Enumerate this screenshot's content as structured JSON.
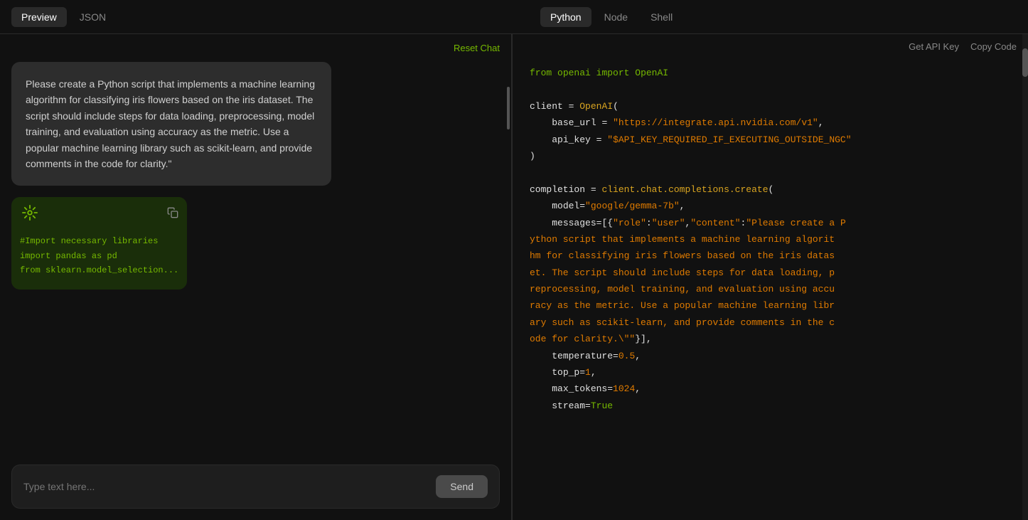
{
  "topbar": {
    "left_tabs": [
      {
        "id": "preview",
        "label": "Preview",
        "active": true
      },
      {
        "id": "json",
        "label": "JSON",
        "active": false
      }
    ],
    "right_tabs": [
      {
        "id": "python",
        "label": "Python",
        "active": true
      },
      {
        "id": "node",
        "label": "Node",
        "active": false
      },
      {
        "id": "shell",
        "label": "Shell",
        "active": false
      }
    ]
  },
  "chat": {
    "reset_label": "Reset Chat",
    "messages": [
      {
        "type": "user",
        "text": "Please create a Python script that implements a machine learning algorithm for classifying iris flowers based on the iris dataset. The script should include steps for data loading, preprocessing, model training, and evaluation using accuracy as the metric. Use a popular machine learning library such as scikit-learn, and provide comments in the code for clarity.\""
      },
      {
        "type": "code",
        "lines": [
          "#Import necessary libraries",
          "import pandas as pd",
          "from sklearn.model_selection..."
        ]
      }
    ],
    "input_placeholder": "Type text here...",
    "send_label": "Send"
  },
  "code_panel": {
    "get_api_key_label": "Get API Key",
    "copy_code_label": "Copy Code",
    "code": {
      "line1_from": "from",
      "line1_module": " openai ",
      "line1_import": "import",
      "line1_class": " OpenAI",
      "line2": "",
      "line3_var": "client",
      "line3_op": " = ",
      "line3_fn": "OpenAI",
      "line3_paren": "(",
      "line4_key": "    base_url",
      "line4_eq": " = ",
      "line4_val": "\"https://integrate.api.nvidia.com/v1\"",
      "line4_comma": ",",
      "line5_key": "    api_key",
      "line5_eq": " = ",
      "line5_val": "\"$API_KEY_REQUIRED_IF_EXECUTING_OUTSIDE_NGC\"",
      "line6_close": ")",
      "completion_var": "completion",
      "completion_eq": " = ",
      "completion_fn": "client.chat.completions.create",
      "model_key": "    model",
      "model_eq": "=",
      "model_val": "\"google/gemma-7b\"",
      "messages_key": "    messages",
      "messages_eq": "=",
      "messages_val": "[{\"role\":\"user\",\"content\":\"Please create a Python script that implements a machine learning algorithm for classifying iris flowers based on the iris dataset. The script should include steps for data loading, preprocessing, model training, and evaluation using accuracy as the metric. Use a popular machine learning library such as scikit-learn, and provide comments in the code for clarity.\\\"\"}],",
      "temp_key": "    temperature",
      "temp_eq": "=",
      "temp_val": "0.5",
      "temp_comma": ",",
      "top_p_key": "    top_p",
      "top_p_eq": "=",
      "top_p_val": "1",
      "top_p_comma": ",",
      "max_tokens_key": "    max_tokens",
      "max_tokens_eq": "=",
      "max_tokens_val": "1024",
      "max_tokens_comma": ",",
      "stream_key": "    stream",
      "stream_eq": "=",
      "stream_val": "True"
    }
  }
}
